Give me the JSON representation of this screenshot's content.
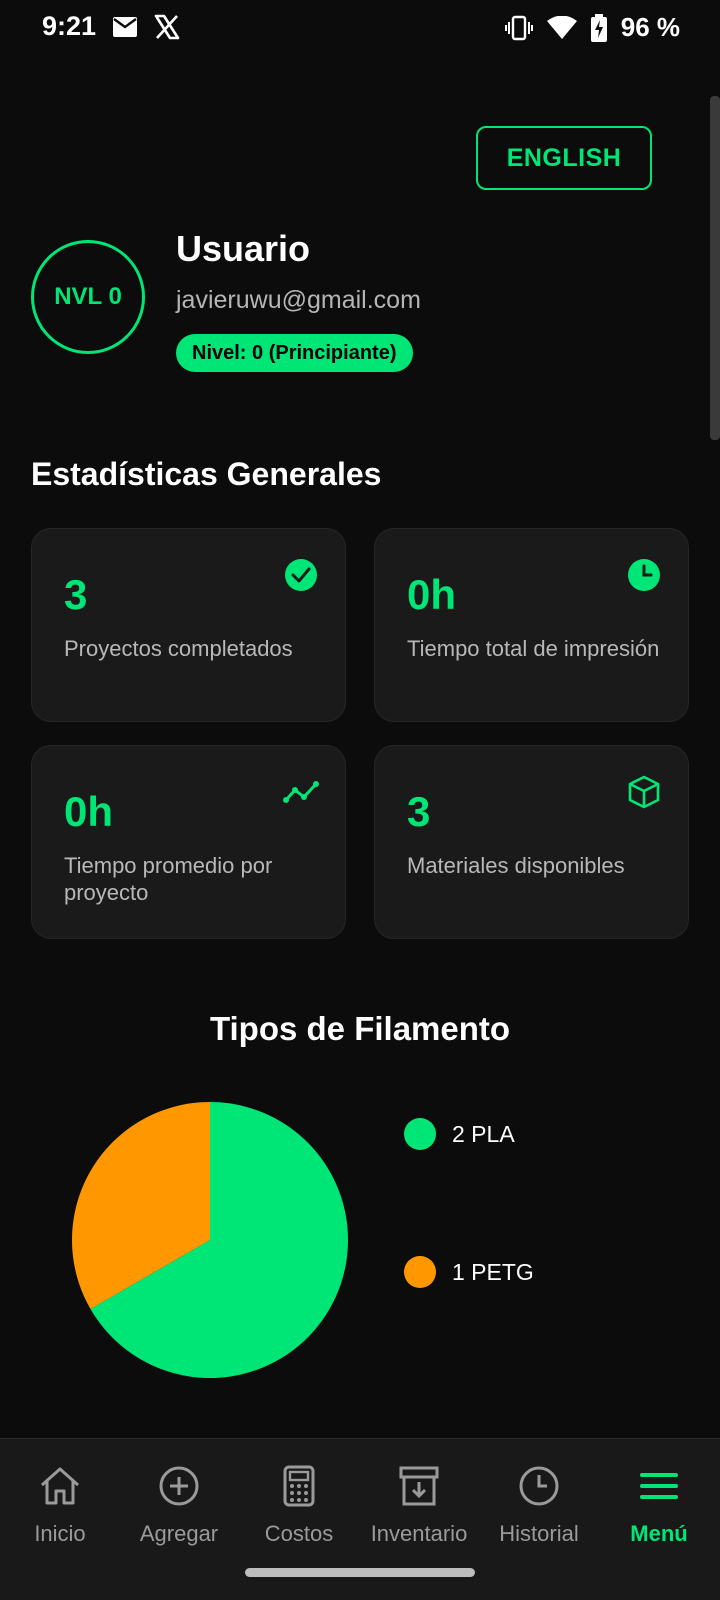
{
  "status_bar": {
    "time": "9:21",
    "battery": "96 %",
    "left_icons": [
      "mail-icon",
      "x-icon"
    ],
    "right_icons": [
      "vibrate-icon",
      "wifi-icon",
      "battery-charging-icon"
    ]
  },
  "language_button": "ENGLISH",
  "profile": {
    "level_ring": "NVL 0",
    "name": "Usuario",
    "email": "javieruwu@gmail.com",
    "level_badge": "Nivel: 0 (Principiante)"
  },
  "stats": {
    "title": "Estadísticas Generales",
    "cards": [
      {
        "value": "3",
        "label": "Proyectos completados",
        "icon": "check-circle-icon"
      },
      {
        "value": "0h",
        "label": "Tiempo total de impresión",
        "icon": "clock-icon"
      },
      {
        "value": "0h",
        "label": "Tiempo promedio por proyecto",
        "icon": "trend-line-icon"
      },
      {
        "value": "3",
        "label": "Materiales disponibles",
        "icon": "cube-icon"
      }
    ]
  },
  "filament": {
    "title": "Tipos de Filamento",
    "legend": [
      "2 PLA",
      "1 PETG"
    ]
  },
  "chart_data": {
    "type": "pie",
    "title": "Tipos de Filamento",
    "categories": [
      "PLA",
      "PETG"
    ],
    "values": [
      2,
      1
    ],
    "colors": [
      "#00e676",
      "#ff9800"
    ],
    "legend_position": "right"
  },
  "nav": {
    "items": [
      {
        "label": "Inicio",
        "icon": "home-icon"
      },
      {
        "label": "Agregar",
        "icon": "add-circle-icon"
      },
      {
        "label": "Costos",
        "icon": "calculator-icon"
      },
      {
        "label": "Inventario",
        "icon": "archive-icon"
      },
      {
        "label": "Historial",
        "icon": "history-clock-icon"
      },
      {
        "label": "Menú",
        "icon": "menu-icon"
      }
    ],
    "active_index": 5
  },
  "colors": {
    "accent": "#00e676",
    "secondary": "#ff9800",
    "background": "#0c0c0c",
    "card": "#1a1a1a"
  }
}
